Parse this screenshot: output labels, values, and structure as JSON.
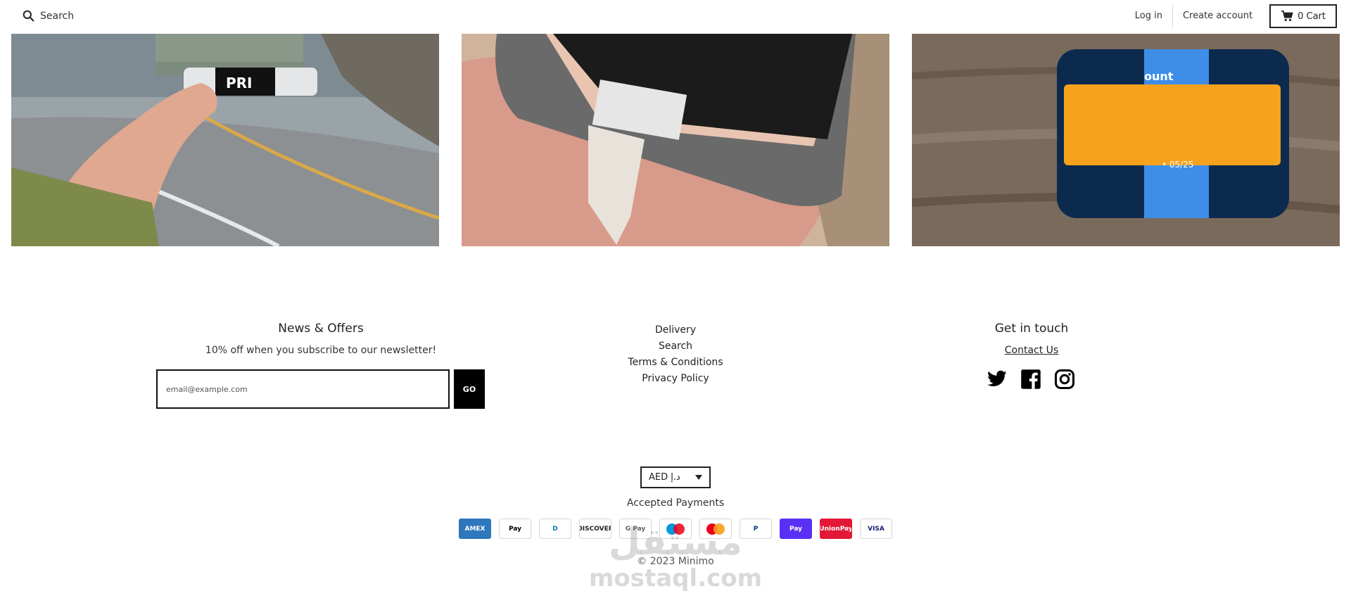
{
  "header": {
    "search_label": "Search",
    "login_label": "Log in",
    "create_account_label": "Create account",
    "cart_label": "0 Cart"
  },
  "photos": [
    {
      "alt_icon": "wallet-on-road-photo"
    },
    {
      "alt_icon": "wallet-in-hand-photo"
    },
    {
      "alt_icon": "wallet-on-wood-photo"
    }
  ],
  "footer": {
    "news": {
      "heading": "News & Offers",
      "text": "10% off when you subscribe to our newsletter!",
      "email_placeholder": "email@example.com",
      "go_label": "GO"
    },
    "links": [
      "Delivery",
      "Search",
      "Terms & Conditions",
      "Privacy Policy"
    ],
    "touch": {
      "heading": "Get in touch",
      "contact_label": "Contact Us",
      "social_icons": [
        "twitter-icon",
        "facebook-icon",
        "instagram-icon"
      ]
    },
    "currency": {
      "selected": "AED د.إ"
    },
    "accepted_payments_label": "Accepted Payments",
    "payments": [
      {
        "name": "AMEX",
        "bg": "#2E77BC",
        "fg": "#ffffff"
      },
      {
        "name": "Pay",
        "bg": "#ffffff",
        "fg": "#000000"
      },
      {
        "name": "D",
        "bg": "#ffffff",
        "fg": "#0079BE"
      },
      {
        "name": "DISCOVER",
        "bg": "#ffffff",
        "fg": "#222222"
      },
      {
        "name": "G Pay",
        "bg": "#ffffff",
        "fg": "#5f6368"
      },
      {
        "name": "maestro",
        "bg": "#ffffff",
        "fg": "#0099DF"
      },
      {
        "name": "mastercard",
        "bg": "#ffffff",
        "fg": "#EB001B"
      },
      {
        "name": "P",
        "bg": "#ffffff",
        "fg": "#003087"
      },
      {
        "name": "Pay",
        "bg": "#5A31F4",
        "fg": "#ffffff"
      },
      {
        "name": "UnionPay",
        "bg": "#E21836",
        "fg": "#ffffff"
      },
      {
        "name": "VISA",
        "bg": "#ffffff",
        "fg": "#1A1F71"
      }
    ],
    "copyright": "© 2023 Minimo"
  },
  "watermark": {
    "arabic": "مستقل",
    "latin": "mostaql.com"
  }
}
